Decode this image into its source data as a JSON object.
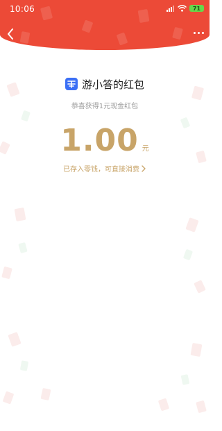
{
  "status_bar": {
    "time": "10:06",
    "battery_level": "71"
  },
  "redpacket": {
    "sender_name": "游小答的红包",
    "subtitle": "恭喜获得1元现金红包",
    "amount": "1.00",
    "unit": "元",
    "link_text": "已存入零钱，可直接消费"
  },
  "colors": {
    "header_red": "#ec4a37",
    "gold": "#c8a468",
    "logo_blue": "#3b6ff5",
    "battery_green": "#67d94a"
  },
  "icons": [
    "back-arrow-icon",
    "more-icon",
    "signal-icon",
    "wifi-icon",
    "battery-icon",
    "app-logo-icon",
    "chevron-right-icon"
  ]
}
